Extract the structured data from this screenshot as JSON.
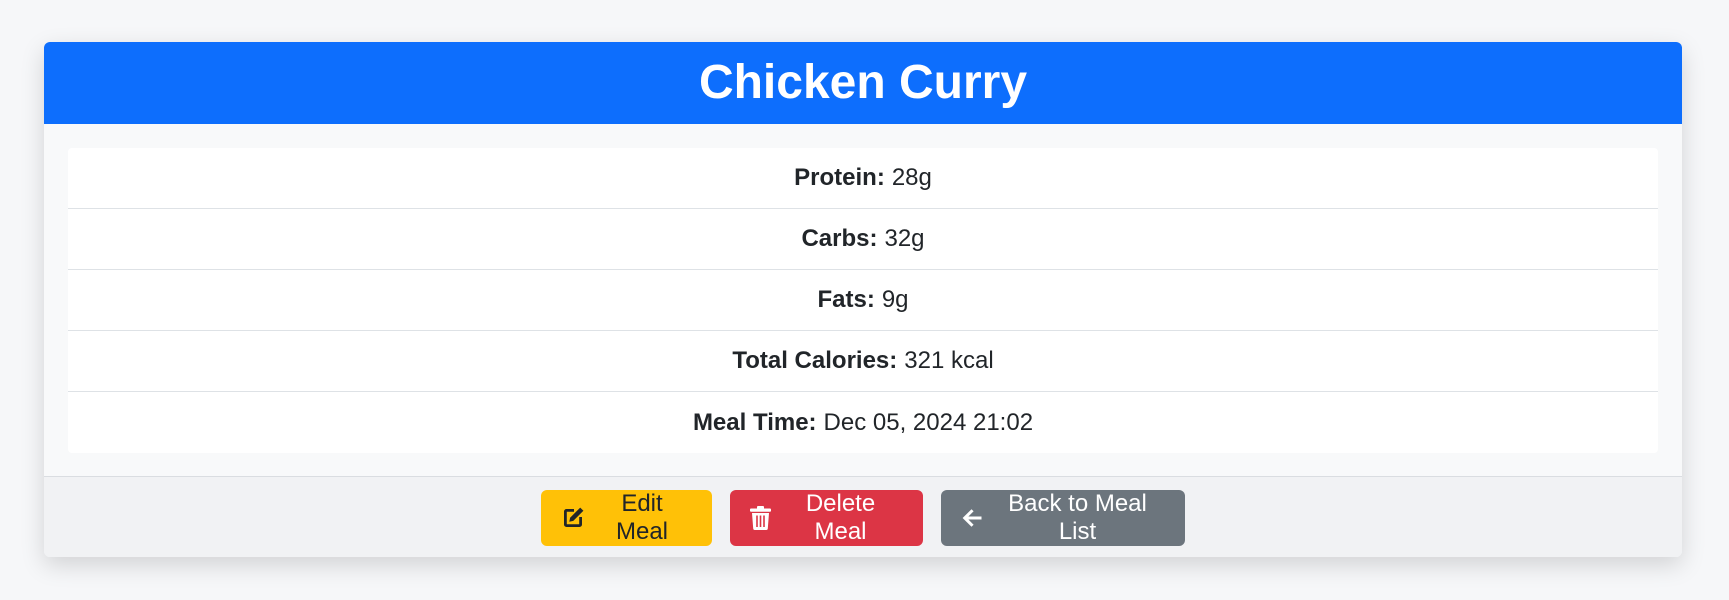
{
  "meal": {
    "title": "Chicken Curry",
    "details": [
      {
        "label": "Protein:",
        "value": "28g"
      },
      {
        "label": "Carbs:",
        "value": "32g"
      },
      {
        "label": "Fats:",
        "value": "9g"
      },
      {
        "label": "Total Calories:",
        "value": "321 kcal"
      },
      {
        "label": "Meal Time:",
        "value": "Dec 05, 2024 21:02"
      }
    ]
  },
  "actions": {
    "edit": {
      "label": "Edit Meal",
      "icon": "edit-icon"
    },
    "delete": {
      "label": "Delete Meal",
      "icon": "trash-icon"
    },
    "back": {
      "label": "Back to Meal List",
      "icon": "arrow-left-icon"
    }
  },
  "colors": {
    "primary": "#0d6efd",
    "warning": "#ffc107",
    "danger": "#dc3545",
    "secondary": "#6c757d"
  }
}
